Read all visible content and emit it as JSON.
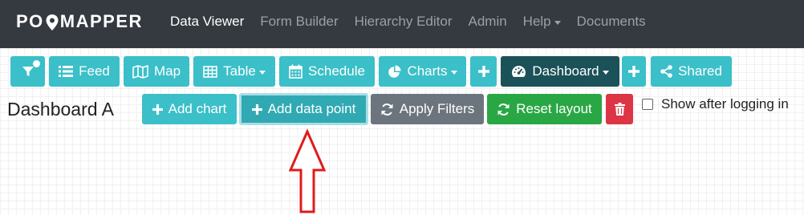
{
  "navbar": {
    "logo": "POIMAPPER",
    "links": [
      {
        "label": "Data Viewer",
        "active": true
      },
      {
        "label": "Form Builder"
      },
      {
        "label": "Hierarchy Editor"
      },
      {
        "label": "Admin"
      },
      {
        "label": "Help",
        "dropdown": true
      },
      {
        "label": "Documents"
      }
    ]
  },
  "toolbar": {
    "feed": "Feed",
    "map": "Map",
    "table": "Table",
    "schedule": "Schedule",
    "charts": "Charts",
    "dashboard": "Dashboard",
    "shared": "Shared"
  },
  "dashboard": {
    "title": "Dashboard A",
    "add_chart": "Add chart",
    "add_data_point": "Add data point",
    "apply_filters": "Apply Filters",
    "reset_layout": "Reset layout",
    "show_after_login": "Show after logging in"
  },
  "colors": {
    "navbar": "#343a40",
    "accent": "#3bbfc9",
    "dark_accent": "#1b5158",
    "arrow": "#e01b1b"
  },
  "icons": {
    "filter": "filter-icon",
    "feed": "list-icon",
    "map": "map-icon",
    "table": "table-icon",
    "schedule": "calendar-icon",
    "charts": "pie-chart-icon",
    "dashboard": "tachometer-icon",
    "shared": "share-icon",
    "add": "plus-icon",
    "refresh": "refresh-icon",
    "delete": "trash-icon"
  }
}
